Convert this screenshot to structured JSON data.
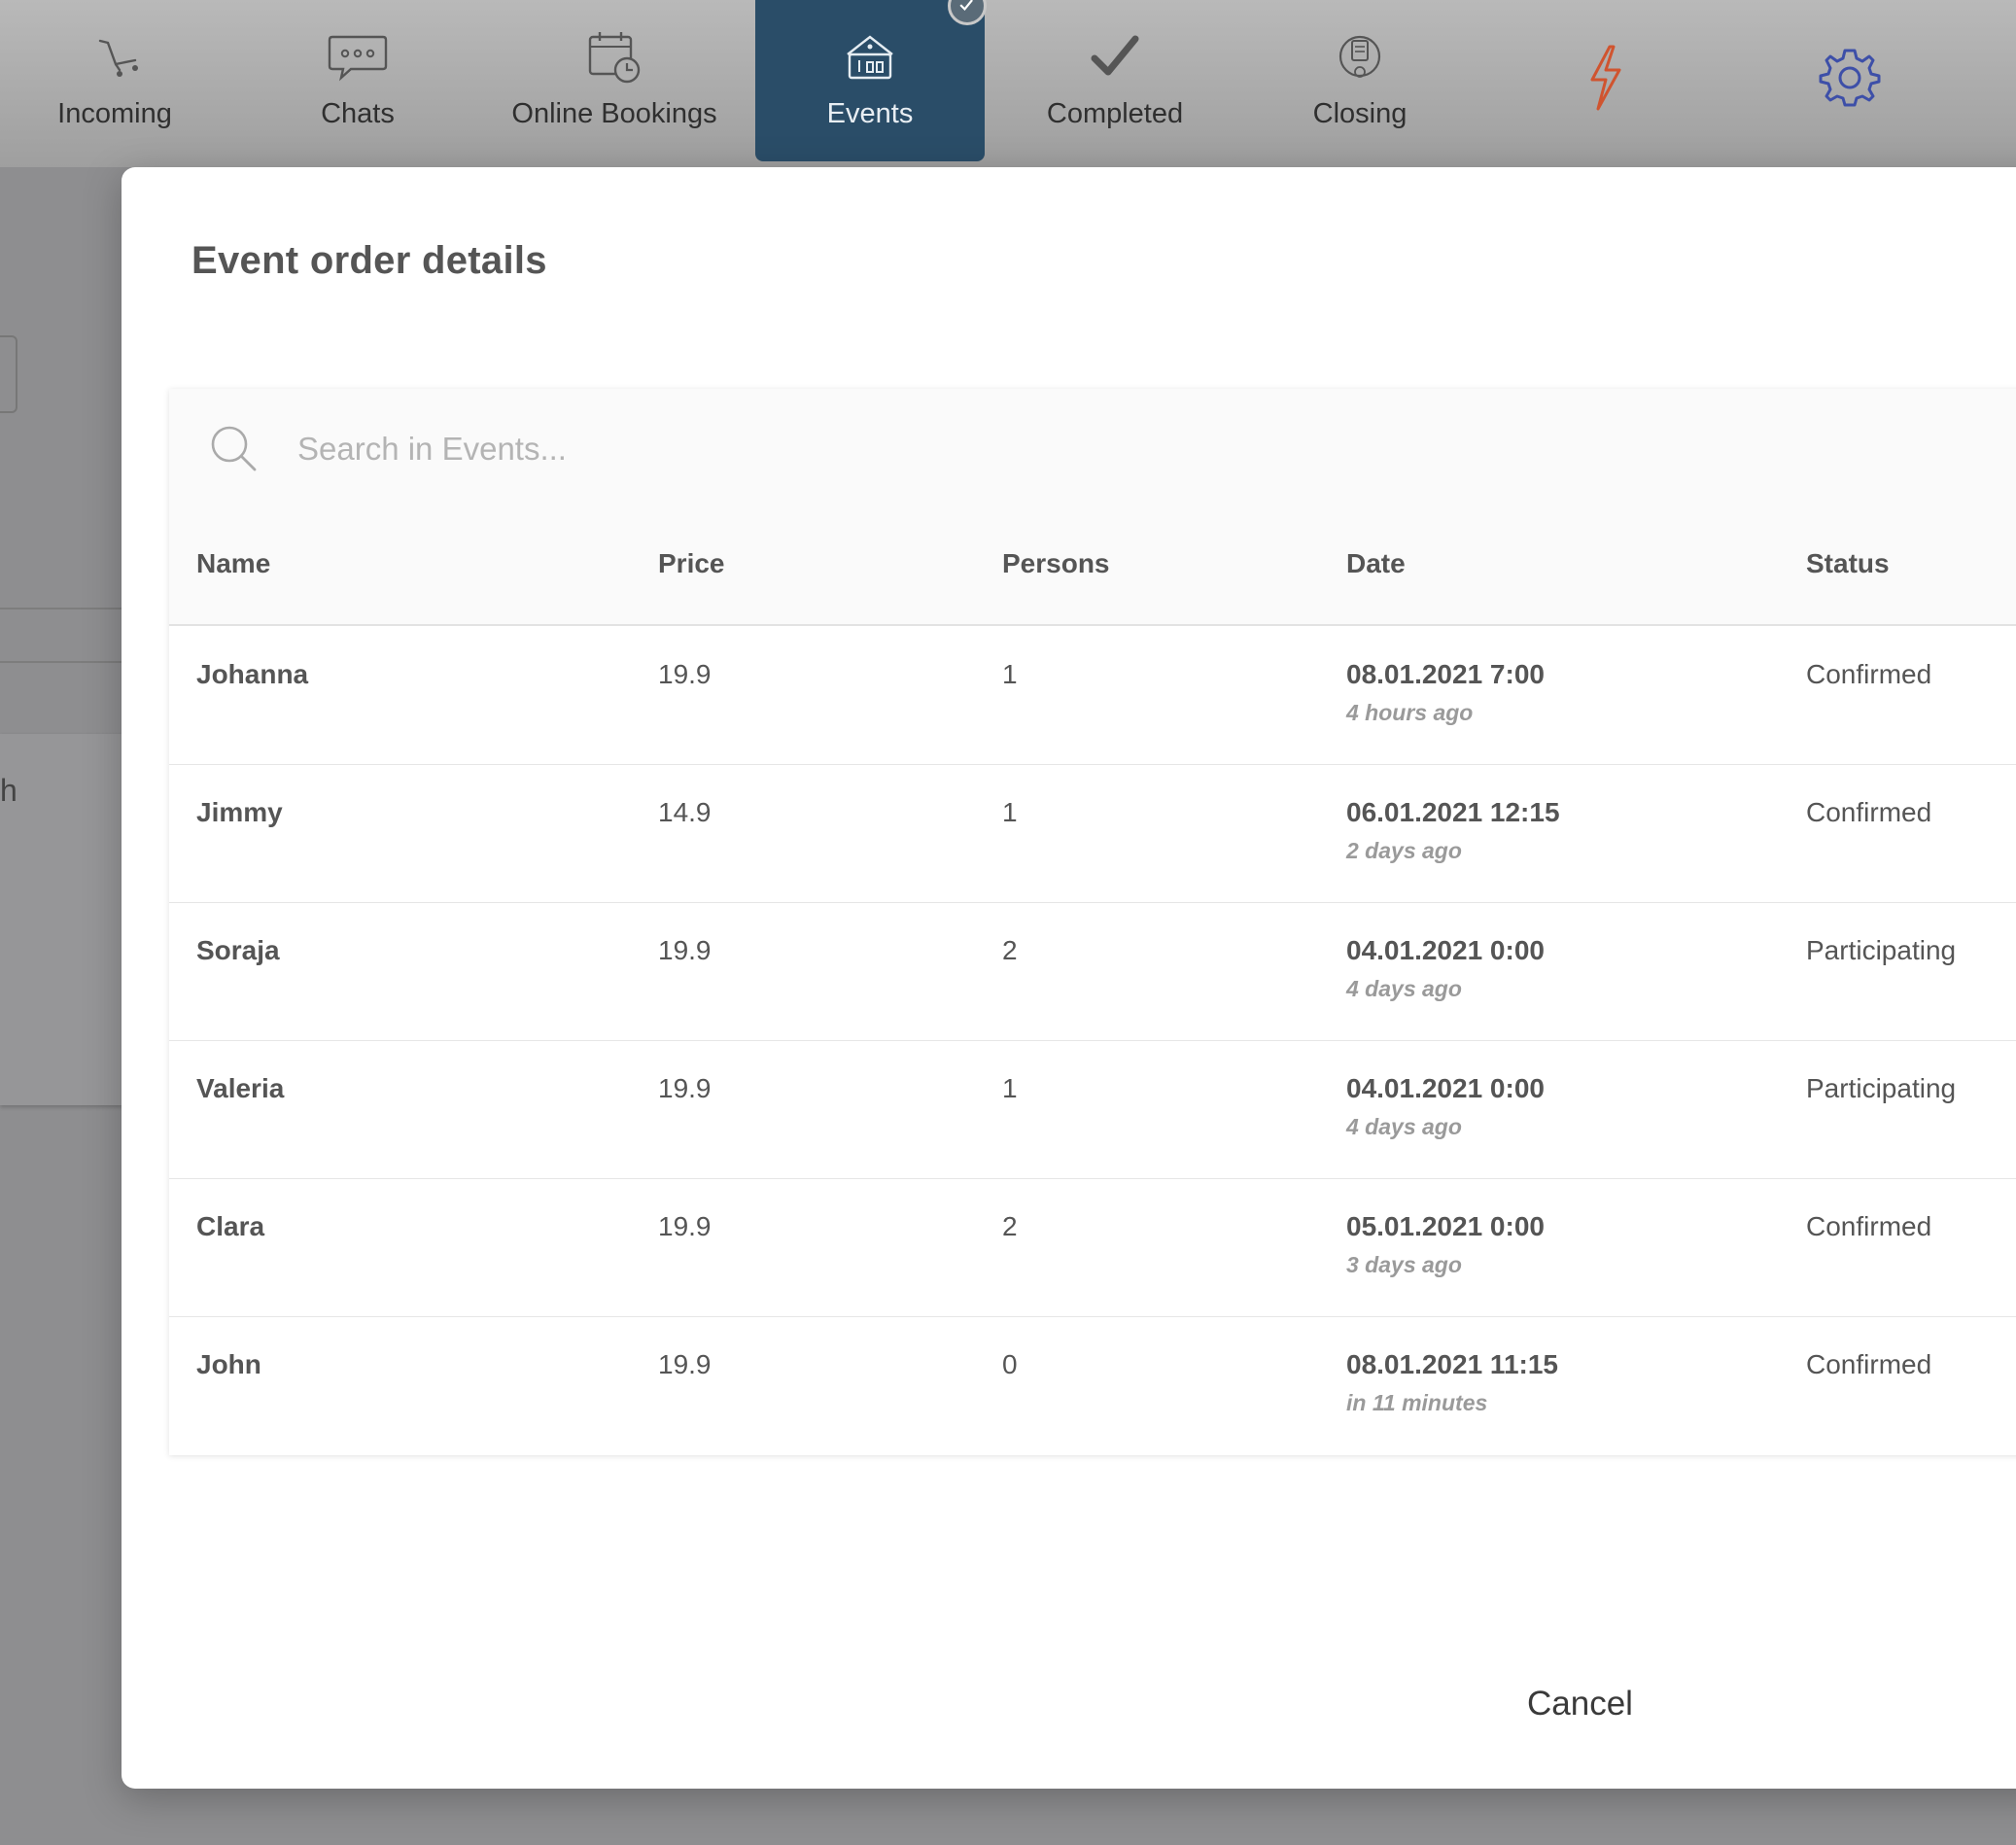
{
  "nav": {
    "items": [
      {
        "label": "Incoming",
        "icon": "cart-icon"
      },
      {
        "label": "Chats",
        "icon": "chat-bubble-icon"
      },
      {
        "label": "Online Bookings",
        "icon": "calendar-clock-icon"
      },
      {
        "label": "Events",
        "icon": "ticket-icon",
        "active": true
      },
      {
        "label": "Completed",
        "icon": "checkmark-icon"
      },
      {
        "label": "Closing",
        "icon": "cash-register-icon"
      },
      {
        "label": "",
        "icon": "lightning-icon"
      },
      {
        "label": "",
        "icon": "gear-icon"
      }
    ],
    "colors": {
      "active_bg": "#2a4d68",
      "lightning": "#d0542f",
      "gear": "#3d4fa8"
    }
  },
  "background": {
    "partial_text": "h"
  },
  "modal": {
    "title": "Event order details",
    "search": {
      "placeholder": "Search in Events..."
    },
    "columns": [
      "Name",
      "Price",
      "Persons",
      "Date",
      "Status"
    ],
    "rows": [
      {
        "name": "Johanna",
        "price": "19.9",
        "persons": "1",
        "date": "08.01.2021 7:00",
        "relative": "4 hours ago",
        "status": "Confirmed"
      },
      {
        "name": "Jimmy",
        "price": "14.9",
        "persons": "1",
        "date": "06.01.2021 12:15",
        "relative": "2 days ago",
        "status": "Confirmed"
      },
      {
        "name": "Soraja",
        "price": "19.9",
        "persons": "2",
        "date": "04.01.2021 0:00",
        "relative": "4 days ago",
        "status": "Participating"
      },
      {
        "name": "Valeria",
        "price": "19.9",
        "persons": "1",
        "date": "04.01.2021 0:00",
        "relative": "4 days ago",
        "status": "Participating"
      },
      {
        "name": "Clara",
        "price": "19.9",
        "persons": "2",
        "date": "05.01.2021 0:00",
        "relative": "3 days ago",
        "status": "Confirmed"
      },
      {
        "name": "John",
        "price": "19.9",
        "persons": "0",
        "date": "08.01.2021 11:15",
        "relative": "in 11 minutes",
        "status": "Confirmed"
      }
    ],
    "cancel_label": "Cancel"
  }
}
